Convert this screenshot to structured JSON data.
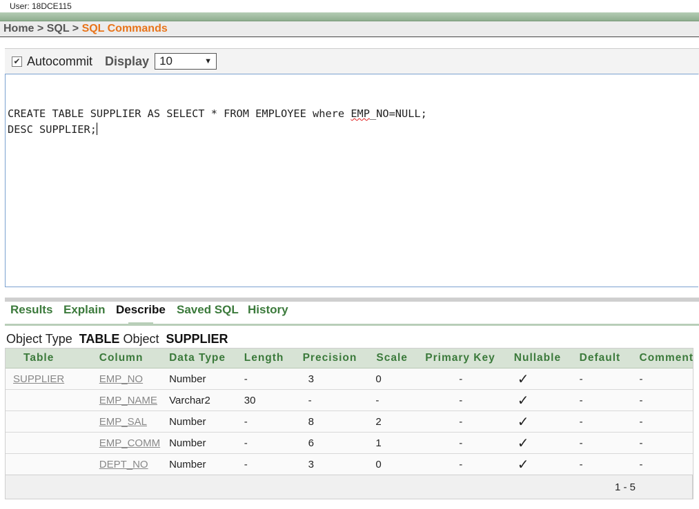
{
  "user": "User: 18DCE115",
  "breadcrumb": {
    "home": "Home",
    "sep": ">",
    "sql": "SQL",
    "current": "SQL Commands"
  },
  "toolbar": {
    "autocommit_label": "Autocommit",
    "display_label": "Display",
    "display_value": "10",
    "autocommit_checked": "✔"
  },
  "editor": {
    "line1_a": "CREATE TABLE SUPPLIER AS SELECT * FROM EMPLOYEE where ",
    "line1_b": "EMP",
    "line1_c": "_NO=NULL;",
    "line2": "DESC SUPPLIER;"
  },
  "tabs": [
    "Results",
    "Explain",
    "Describe",
    "Saved SQL",
    "History"
  ],
  "object": {
    "type_label": "Object Type",
    "type_value": "TABLE",
    "object_label": "Object",
    "object_value": "SUPPLIER"
  },
  "table": {
    "headers": [
      "Table",
      "Column",
      "Data Type",
      "Length",
      "Precision",
      "Scale",
      "Primary Key",
      "Nullable",
      "Default",
      "Comment"
    ],
    "rows": [
      [
        "SUPPLIER",
        "EMP_NO",
        "Number",
        "-",
        "3",
        "0",
        "-",
        "✓",
        "-",
        "-"
      ],
      [
        "",
        "EMP_NAME",
        "Varchar2",
        "30",
        "-",
        "-",
        "-",
        "✓",
        "-",
        "-"
      ],
      [
        "",
        "EMP_SAL",
        "Number",
        "-",
        "8",
        "2",
        "-",
        "✓",
        "-",
        "-"
      ],
      [
        "",
        "EMP_COMM",
        "Number",
        "-",
        "6",
        "1",
        "-",
        "✓",
        "-",
        "-"
      ],
      [
        "",
        "DEPT_NO",
        "Number",
        "-",
        "3",
        "0",
        "-",
        "✓",
        "-",
        "-"
      ]
    ],
    "pagination": "1 - 5"
  }
}
